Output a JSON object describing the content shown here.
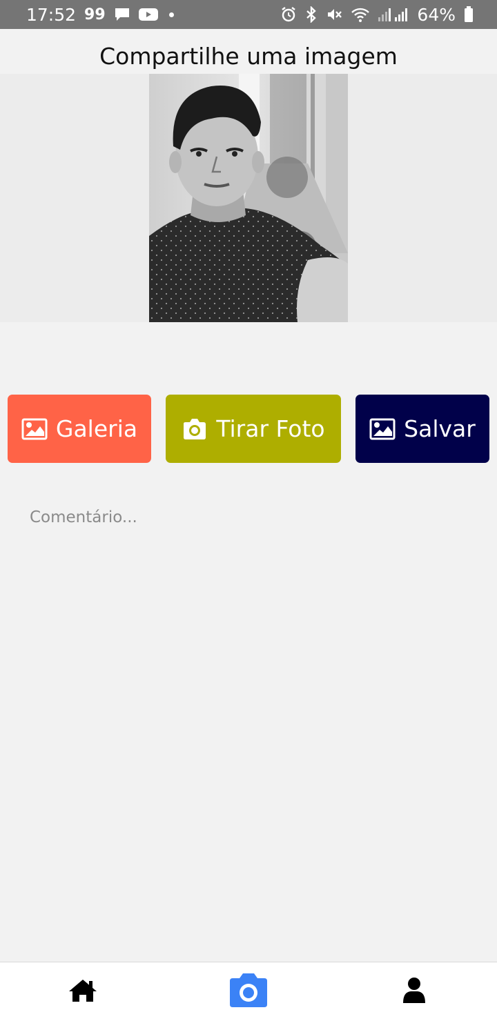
{
  "status_bar": {
    "time": "17:52",
    "notif_label": "99",
    "battery": "64%",
    "icons": [
      "message-icon",
      "youtube-icon",
      "dot-icon",
      "alarm-icon",
      "bluetooth-icon",
      "mute-icon",
      "wifi-icon",
      "signal-icon",
      "battery-icon"
    ]
  },
  "header": {
    "title": "Compartilhe uma imagem"
  },
  "buttons": {
    "gallery": {
      "label": "Galeria",
      "icon": "image-icon",
      "color": "#ff6347"
    },
    "camera": {
      "label": "Tirar Foto",
      "icon": "camera-icon",
      "color": "#aeae00"
    },
    "save": {
      "label": "Salvar",
      "icon": "image-icon",
      "color": "#01014a"
    }
  },
  "comment": {
    "placeholder": "Comentário...",
    "value": ""
  },
  "bottom_nav": {
    "items": [
      {
        "name": "home",
        "icon": "home-icon",
        "active": false
      },
      {
        "name": "camera",
        "icon": "camera-icon",
        "active": true,
        "color": "#3b82f6"
      },
      {
        "name": "profile",
        "icon": "user-icon",
        "active": false
      }
    ]
  }
}
